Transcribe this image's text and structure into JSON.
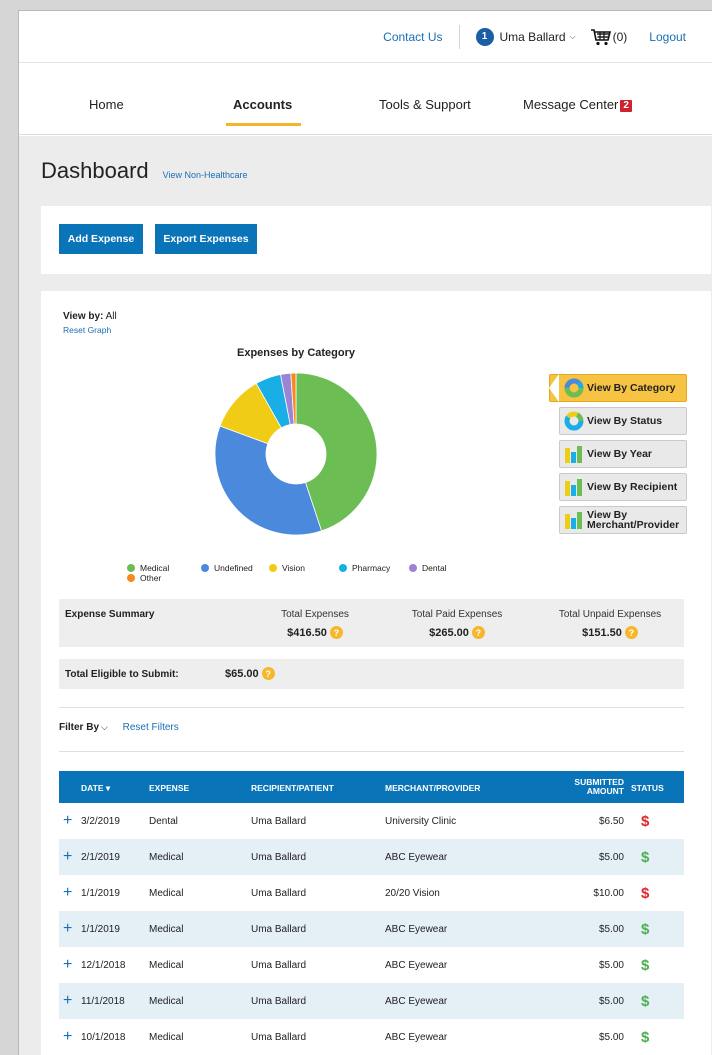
{
  "header": {
    "contact": "Contact Us",
    "user_initial": "1",
    "user_name": "Uma Ballard",
    "cart": "(0)",
    "logout": "Logout"
  },
  "nav": {
    "tabs": [
      "Home",
      "Accounts",
      "Tools & Support",
      "Message Center"
    ],
    "active": "Accounts",
    "message_badge": "2"
  },
  "dashboard": {
    "title": "Dashboard",
    "link": "View Non-Healthcare",
    "add_expense": "Add Expense",
    "export_expenses": "Export Expenses"
  },
  "graph": {
    "view_by_label": "View by:",
    "view_by_value": " All",
    "reset_graph": "Reset Graph",
    "view_buttons": [
      "View By Category",
      "View By Status",
      "View By Year",
      "View By Recipient",
      "View By Merchant/Provider"
    ]
  },
  "chart_data": {
    "type": "pie",
    "title": "Expenses by Category",
    "categories": [
      "Medical",
      "Undefined",
      "Vision",
      "Pharmacy",
      "Dental",
      "Other"
    ],
    "values": [
      44,
      35,
      11,
      5,
      2,
      1
    ],
    "colors": [
      "#6cbd53",
      "#4a89dc",
      "#f0cc16",
      "#19aee6",
      "#9b83d6",
      "#f6891f"
    ],
    "legend": "bottom"
  },
  "summary": {
    "label": "Expense Summary",
    "total_label": "Total Expenses",
    "total_value": "$416.50",
    "paid_label": "Total Paid Expenses",
    "paid_value": "$265.00",
    "unpaid_label": "Total Unpaid Expenses",
    "unpaid_value": "$151.50",
    "eligible_label": "Total Eligible to Submit:",
    "eligible_value": "$65.00",
    "help_icon": "?"
  },
  "filter": {
    "label": "Filter By",
    "chevron": "⌵",
    "reset": "Reset Filters"
  },
  "table": {
    "headers": {
      "date": "DATE ▾",
      "expense": "EXPENSE",
      "recipient": "RECIPIENT/PATIENT",
      "merchant": "MERCHANT/PROVIDER",
      "submitted_1": "SUBMITTED",
      "submitted_2": "AMOUNT",
      "status": "STATUS"
    },
    "expand_icon": "+",
    "rows": [
      {
        "date": "3/2/2019",
        "expense": "Dental",
        "recipient": "Uma Ballard",
        "merchant": "University Clinic",
        "amount": "$6.50",
        "status": "$",
        "status_color": "#e0242c"
      },
      {
        "date": "2/1/2019",
        "expense": "Medical",
        "recipient": "Uma Ballard",
        "merchant": "ABC Eyewear",
        "amount": "$5.00",
        "status": "$",
        "status_color": "#4caf50"
      },
      {
        "date": "1/1/2019",
        "expense": "Medical",
        "recipient": "Uma Ballard",
        "merchant": "20/20 Vision",
        "amount": "$10.00",
        "status": "$",
        "status_color": "#e0242c"
      },
      {
        "date": "1/1/2019",
        "expense": "Medical",
        "recipient": "Uma Ballard",
        "merchant": "ABC Eyewear",
        "amount": "$5.00",
        "status": "$",
        "status_color": "#4caf50"
      },
      {
        "date": "12/1/2018",
        "expense": "Medical",
        "recipient": "Uma Ballard",
        "merchant": "ABC Eyewear",
        "amount": "$5.00",
        "status": "$",
        "status_color": "#4caf50"
      },
      {
        "date": "11/1/2018",
        "expense": "Medical",
        "recipient": "Uma Ballard",
        "merchant": "ABC Eyewear",
        "amount": "$5.00",
        "status": "$",
        "status_color": "#4caf50"
      },
      {
        "date": "10/1/2018",
        "expense": "Medical",
        "recipient": "Uma Ballard",
        "merchant": "ABC Eyewear",
        "amount": "$5.00",
        "status": "$",
        "status_color": "#4caf50"
      }
    ]
  }
}
